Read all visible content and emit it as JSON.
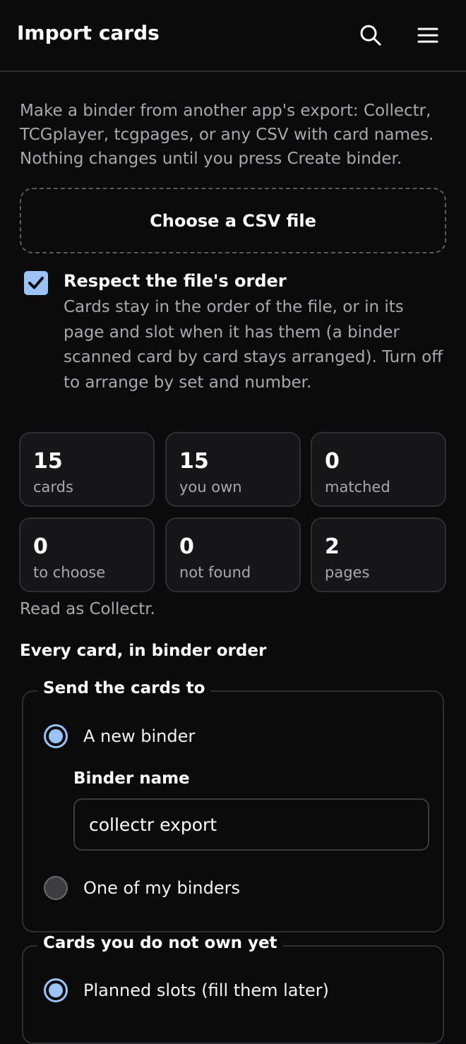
{
  "header": {
    "title": "Import cards"
  },
  "intro": "Make a binder from another app's export: Collectr, TCGplayer, tcgpages, or any CSV with card names. Nothing changes until you press Create binder.",
  "file_picker": {
    "label": "Choose a CSV file"
  },
  "respect_order": {
    "checked": true,
    "title": "Respect the file's order",
    "description": "Cards stay in the order of the file, or in its page and slot when it has them (a binder scanned card by card stays arranged). Turn off to arrange by set and number."
  },
  "stats": [
    {
      "value": "15",
      "label": "cards"
    },
    {
      "value": "15",
      "label": "you own"
    },
    {
      "value": "0",
      "label": "matched"
    },
    {
      "value": "0",
      "label": "to choose"
    },
    {
      "value": "0",
      "label": "not found"
    },
    {
      "value": "2",
      "label": "pages"
    }
  ],
  "read_as": "Read as Collectr.",
  "section_title": "Every card, in binder order",
  "destination": {
    "legend": "Send the cards to",
    "option_new": "A new binder",
    "option_new_selected": true,
    "binder_name_label": "Binder name",
    "binder_name_value": "collectr export",
    "option_existing": "One of my binders",
    "option_existing_selected": false
  },
  "unowned": {
    "legend": "Cards you do not own yet",
    "option_planned": "Planned slots (fill them later)",
    "option_planned_selected": true
  },
  "colors": {
    "accent": "#9cc3f5",
    "background": "#0b0b0c",
    "card_background": "#161618",
    "border": "#2e2e33",
    "muted_text": "#a9a9ad"
  },
  "icons": {
    "search": "search-icon",
    "menu": "menu-icon",
    "check": "check-icon"
  }
}
